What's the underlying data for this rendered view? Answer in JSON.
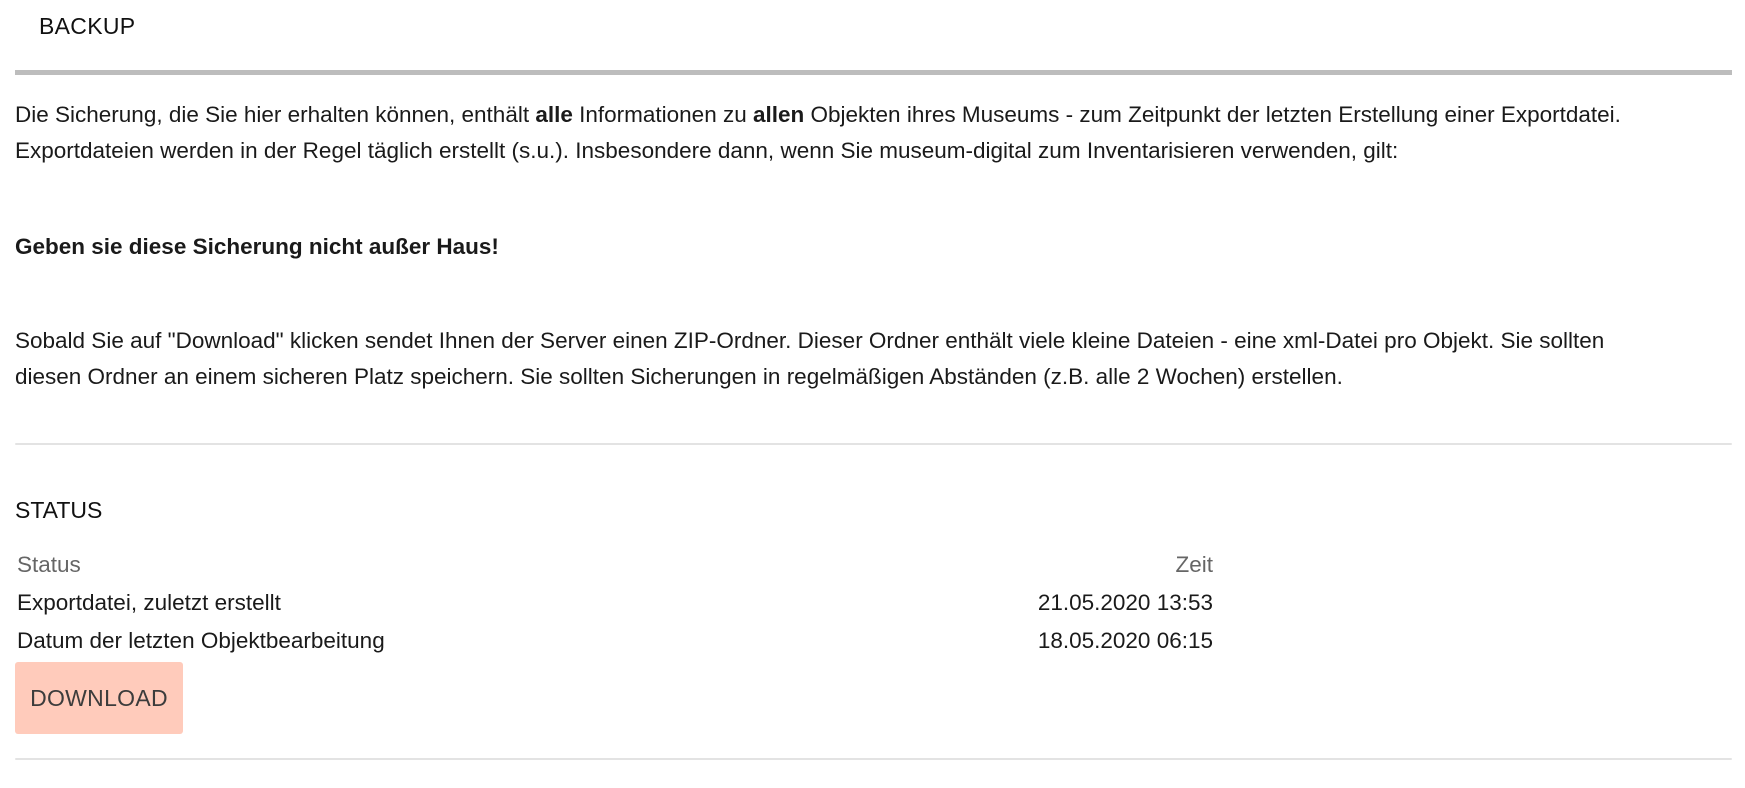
{
  "header": {
    "tab_title": "BACKUP"
  },
  "intro": {
    "line1_part1": "Die Sicherung, die Sie hier erhalten können, enthält ",
    "line1_bold1": "alle",
    "line1_part2": " Informationen zu ",
    "line1_bold2": "allen",
    "line1_part3": " Objekten ihres Museums - zum Zeitpunkt der letzten Erstellung einer Exportdatei.",
    "line2": "Exportdateien werden in der Regel täglich erstellt (s.u.). Insbesondere dann, wenn Sie museum-digital zum Inventarisieren verwenden, gilt:"
  },
  "warning": "Geben sie diese Sicherung nicht außer Haus!",
  "instructions": {
    "line1": "Sobald Sie auf \"Download\" klicken sendet Ihnen der Server einen ZIP-Ordner. Dieser Ordner enthält viele kleine Dateien - eine xml-Datei pro Objekt. Sie sollten",
    "line2": "diesen Ordner an einem sicheren Platz speichern. Sie sollten Sicherungen in regelmäßigen Abständen (z.B. alle 2 Wochen) erstellen."
  },
  "status_section": {
    "title": "STATUS",
    "columns": {
      "status": "Status",
      "time": "Zeit"
    },
    "rows": [
      {
        "label": "Exportdatei, zuletzt erstellt",
        "time": "21.05.2020 13:53"
      },
      {
        "label": "Datum der letzten Objektbearbeitung",
        "time": "18.05.2020 06:15"
      }
    ],
    "download_label": "DOWNLOAD"
  },
  "colors": {
    "download_button_bg": "#ffcbbb",
    "header_rule": "#bdbdbd",
    "divider": "#e3e3e3",
    "muted_text": "#666666"
  }
}
